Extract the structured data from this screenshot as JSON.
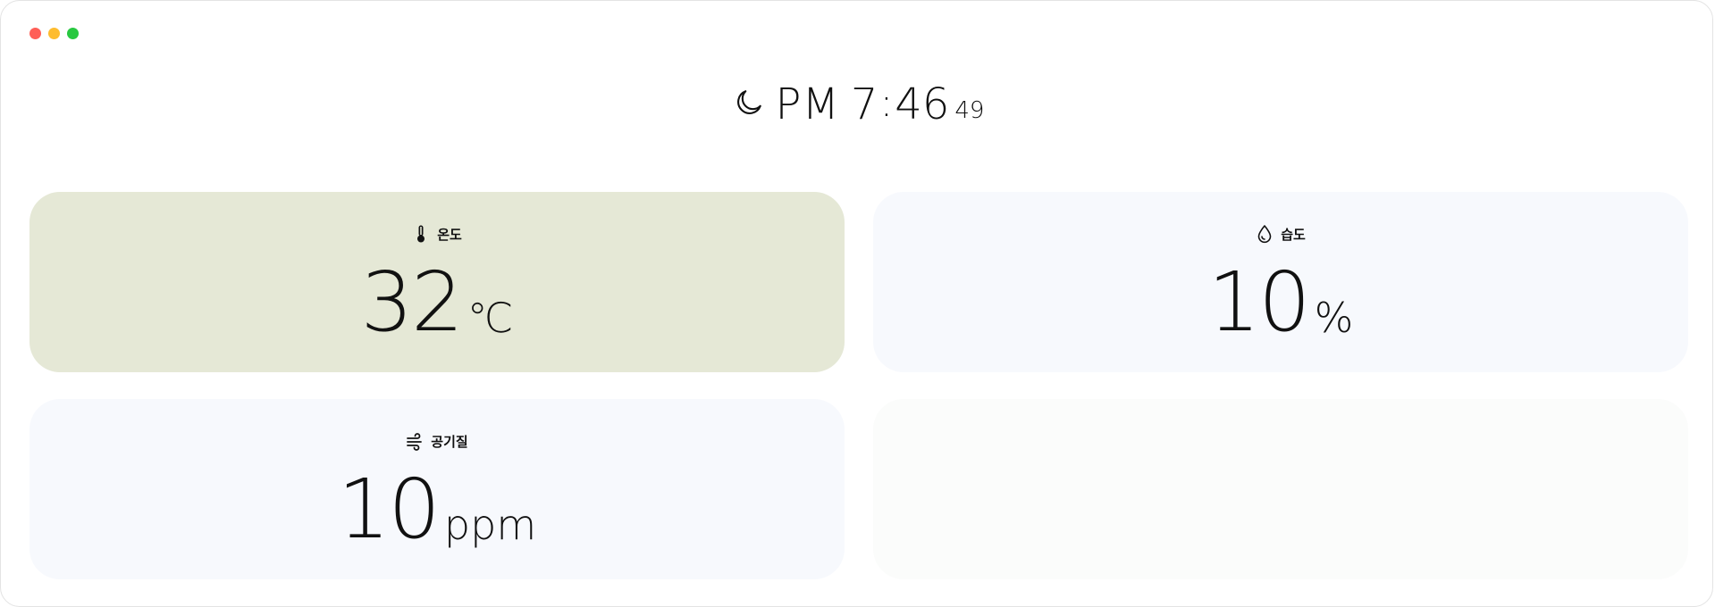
{
  "window": {
    "controls": [
      {
        "name": "close",
        "color": "#ff5f57"
      },
      {
        "name": "minimize",
        "color": "#febc2e"
      },
      {
        "name": "zoom",
        "color": "#28c840"
      }
    ]
  },
  "clock": {
    "icon": "moon-icon",
    "ampm": "PM",
    "hour": "7",
    "colon": ":",
    "minute": "46",
    "seconds": "49"
  },
  "cards": {
    "temperature": {
      "icon": "thermometer-icon",
      "label": "온도",
      "value": "32",
      "unit": "℃",
      "background": "#e5e8d6"
    },
    "humidity": {
      "icon": "droplet-icon",
      "label": "습도",
      "value": "10",
      "unit": "%",
      "background": "#f7f9fd"
    },
    "air_quality": {
      "icon": "wind-icon",
      "label": "공기질",
      "value": "10",
      "unit": "ppm",
      "background": "#f7f9fd"
    },
    "empty": {
      "background": "#fbfcfb"
    }
  }
}
